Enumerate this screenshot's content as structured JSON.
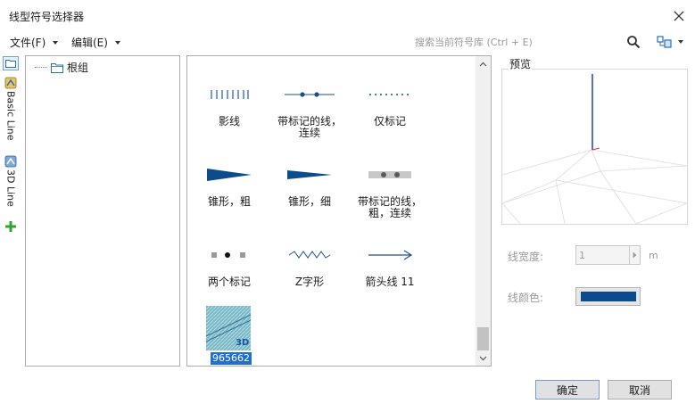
{
  "window": {
    "title": "线型符号选择器"
  },
  "menu": [
    {
      "label": "文件(F)"
    },
    {
      "label": "编辑(E)"
    }
  ],
  "search": {
    "placeholder": "搜索当前符号库 (Ctrl + E)",
    "value": ""
  },
  "side_tabs": [
    {
      "label": "Basic Line",
      "icon": "basic-line-tab-icon"
    },
    {
      "label": "3D Line",
      "icon": "3d-line-tab-icon"
    }
  ],
  "tree": {
    "root_label": "根组"
  },
  "symbols": [
    {
      "label": "影线",
      "kind": "hatch"
    },
    {
      "label": "带标记的线，\n连续",
      "kind": "line-markers"
    },
    {
      "label": "仅标记",
      "kind": "dots"
    },
    {
      "label": "锥形，粗",
      "kind": "taper-thick"
    },
    {
      "label": "锥形，细",
      "kind": "taper-thin"
    },
    {
      "label": "带标记的线，\n粗，连续",
      "kind": "thick-markers"
    },
    {
      "label": "两个标记",
      "kind": "two-markers"
    },
    {
      "label": "Z字形",
      "kind": "zigzag"
    },
    {
      "label": "箭头线 11",
      "kind": "arrow"
    },
    {
      "label": "965662",
      "kind": "3d",
      "badge": "3D",
      "selected": true
    }
  ],
  "preview": {
    "label": "预览"
  },
  "properties": {
    "width_label": "线宽度:",
    "width_value": "1",
    "width_unit": "m",
    "color_label": "线颜色:",
    "color_value": "#0d4c8c"
  },
  "buttons": {
    "ok": "确定",
    "cancel": "取消"
  },
  "colors": {
    "accent": "#0d4c8c",
    "selection": "#1e6fd1"
  }
}
